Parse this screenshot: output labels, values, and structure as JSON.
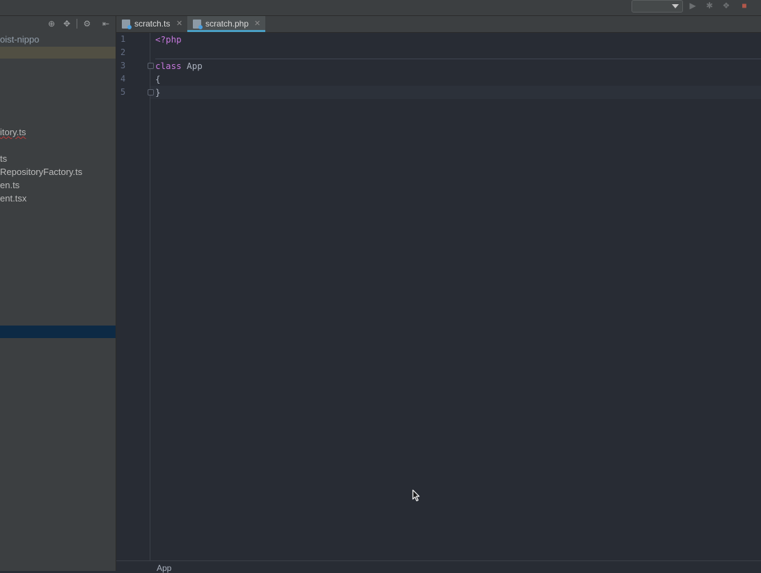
{
  "topbar": {
    "run_config": "",
    "icons": [
      "run-icon",
      "debug-icon",
      "coverage-icon",
      "stop-icon"
    ]
  },
  "sidebar": {
    "toolbar_icons": [
      "locate-icon",
      "collapse-icon",
      "gear-icon",
      "hide-icon"
    ],
    "project_name": "oist-nippo",
    "items": [
      {
        "label": "itory.ts",
        "error": true
      },
      {
        "label": "ts",
        "error": false
      },
      {
        "label": "RepositoryFactory.ts",
        "error": false
      },
      {
        "label": "en.ts",
        "error": false
      },
      {
        "label": "ent.tsx",
        "error": false
      }
    ]
  },
  "tabs": [
    {
      "label": "scratch.ts",
      "active": false
    },
    {
      "label": "scratch.php",
      "active": true
    }
  ],
  "editor": {
    "line_numbers": [
      "1",
      "2",
      "3",
      "4",
      "5"
    ],
    "lines": {
      "l1_tag": "<?php",
      "l3_keyword": "class",
      "l3_name": " App",
      "l4": "{",
      "l5": "}"
    }
  },
  "breadcrumbs": {
    "item": "App"
  },
  "colors": {
    "editor_bg": "#282c34",
    "sidebar_bg": "#3c3f41",
    "keyword": "#c678dd",
    "tab_underline": "#4a9fc4",
    "selected_row": "#0d2a45"
  }
}
